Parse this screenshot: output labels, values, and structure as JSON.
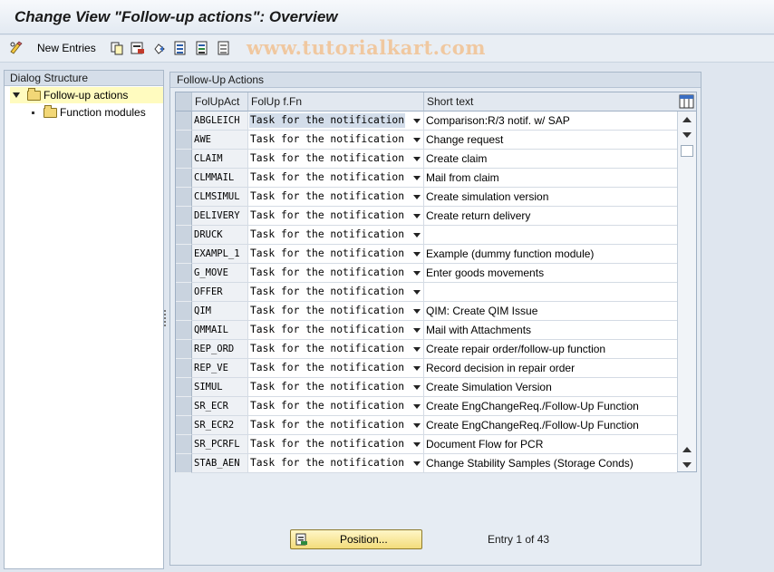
{
  "window": {
    "title": "Change View \"Follow-up actions\": Overview"
  },
  "toolbar": {
    "new_entries_label": "New Entries",
    "watermark": "www.tutorialkart.com"
  },
  "dialog_structure": {
    "header": "Dialog Structure",
    "items": [
      {
        "label": "Follow-up actions"
      },
      {
        "label": "Function modules"
      }
    ]
  },
  "main": {
    "header": "Follow-Up Actions",
    "columns": [
      "FolUpAct",
      "FolUp f.Fn",
      "Short text"
    ],
    "rows": [
      {
        "key": "ABGLEICH",
        "fn": "Task for the notification",
        "text": "Comparison:R/3 notif. w/ SAP"
      },
      {
        "key": "AWE",
        "fn": "Task for the notification",
        "text": "Change request"
      },
      {
        "key": "CLAIM",
        "fn": "Task for the notification",
        "text": "Create claim"
      },
      {
        "key": "CLMMAIL",
        "fn": "Task for the notification",
        "text": "Mail from claim"
      },
      {
        "key": "CLMSIMUL",
        "fn": "Task for the notification",
        "text": "Create simulation version"
      },
      {
        "key": "DELIVERY",
        "fn": "Task for the notification",
        "text": "Create return delivery"
      },
      {
        "key": "DRUCK",
        "fn": "Task for the notification",
        "text": ""
      },
      {
        "key": "EXAMPL_1",
        "fn": "Task for the notification",
        "text": "Example (dummy function module)"
      },
      {
        "key": "G_MOVE",
        "fn": "Task for the notification",
        "text": "Enter goods movements"
      },
      {
        "key": "OFFER",
        "fn": "Task for the notification",
        "text": ""
      },
      {
        "key": "QIM",
        "fn": "Task for the notification",
        "text": "QIM: Create QIM Issue"
      },
      {
        "key": "QMMAIL",
        "fn": "Task for the notification",
        "text": "Mail with Attachments"
      },
      {
        "key": "REP_ORD",
        "fn": "Task for the notification",
        "text": "Create repair order/follow-up function"
      },
      {
        "key": "REP_VE",
        "fn": "Task for the notification",
        "text": "Record decision in repair order"
      },
      {
        "key": "SIMUL",
        "fn": "Task for the notification",
        "text": "Create Simulation Version"
      },
      {
        "key": "SR_ECR",
        "fn": "Task for the notification",
        "text": "Create EngChangeReq./Follow-Up Function"
      },
      {
        "key": "SR_ECR2",
        "fn": "Task for the notification",
        "text": "Create EngChangeReq./Follow-Up Function"
      },
      {
        "key": "SR_PCRFL",
        "fn": "Task for the notification",
        "text": "Document Flow for PCR"
      },
      {
        "key": "STAB_AEN",
        "fn": "Task for the notification",
        "text": "Change Stability Samples (Storage Conds)"
      }
    ],
    "position_label": "Position...",
    "entry_info": "Entry 1 of 43"
  }
}
